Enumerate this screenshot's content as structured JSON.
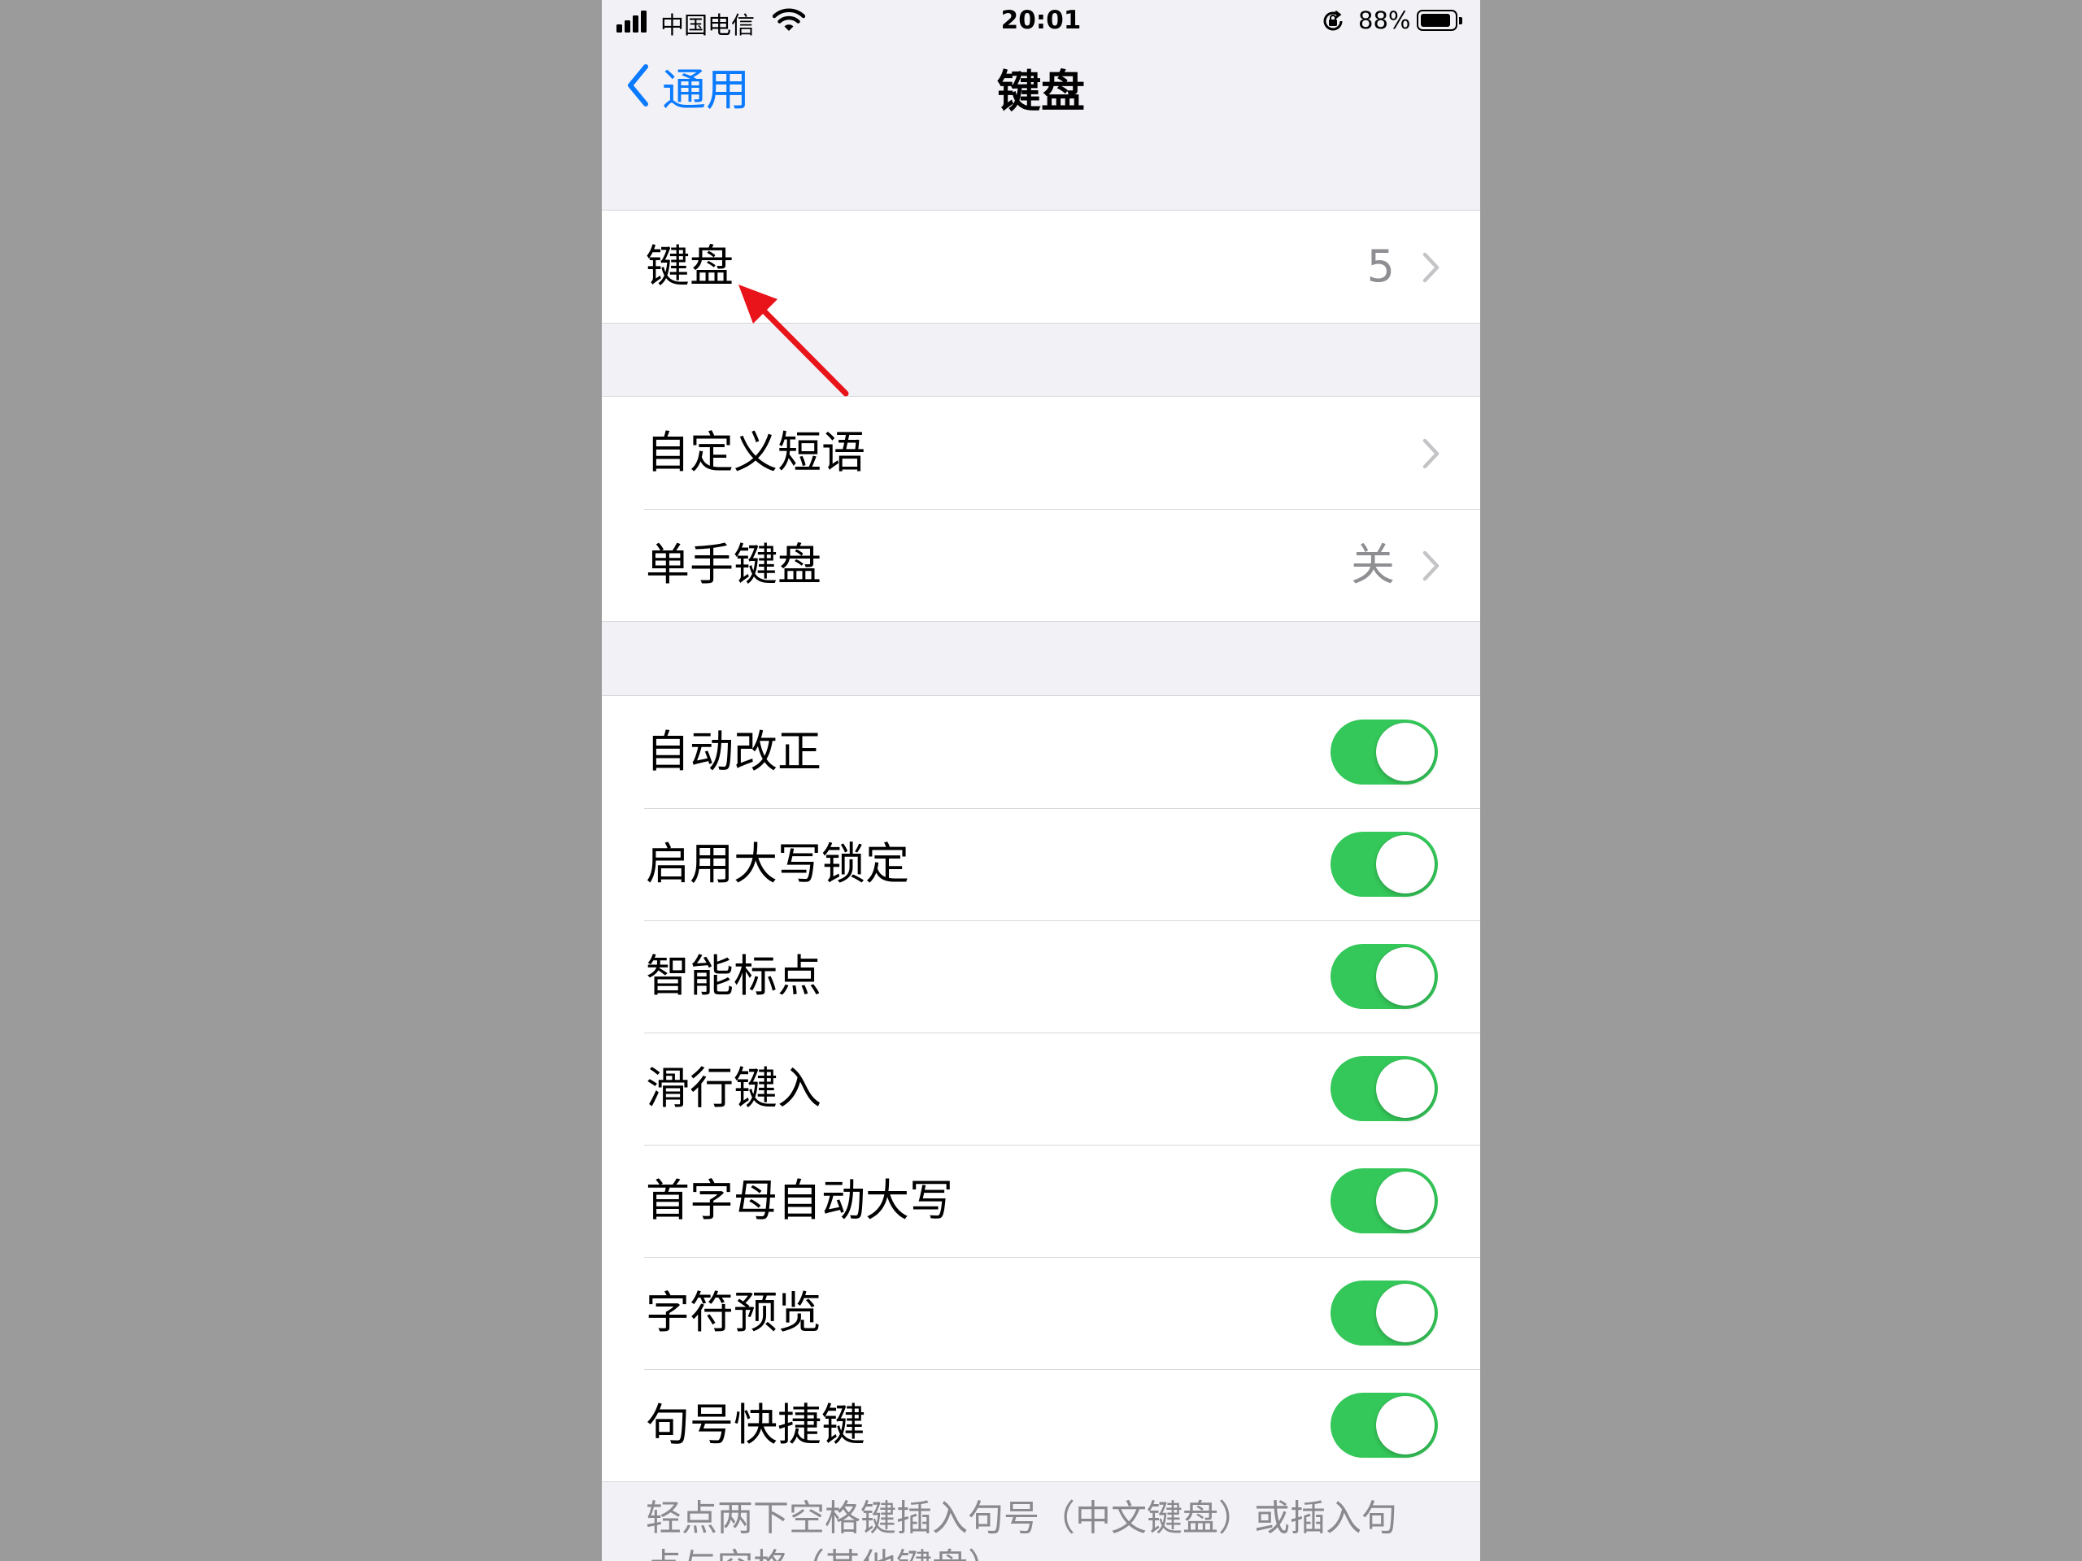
{
  "status_bar": {
    "carrier": "中国电信",
    "time": "20:01",
    "battery": "88%",
    "battery_level": 0.88,
    "icons": [
      "signal-icon",
      "wifi-icon",
      "rotation-lock-icon",
      "battery-icon"
    ]
  },
  "nav": {
    "back_label": "通用",
    "title": "键盘"
  },
  "groups": [
    {
      "rows": [
        {
          "label": "键盘",
          "value": "5",
          "type": "disclosure"
        }
      ]
    },
    {
      "rows": [
        {
          "label": "自定义短语",
          "value": "",
          "type": "disclosure"
        },
        {
          "label": "单手键盘",
          "value": "关",
          "type": "disclosure"
        }
      ]
    },
    {
      "rows": [
        {
          "label": "自动改正",
          "type": "toggle",
          "on": true
        },
        {
          "label": "启用大写锁定",
          "type": "toggle",
          "on": true
        },
        {
          "label": "智能标点",
          "type": "toggle",
          "on": true
        },
        {
          "label": "滑行键入",
          "type": "toggle",
          "on": true
        },
        {
          "label": "首字母自动大写",
          "type": "toggle",
          "on": true
        },
        {
          "label": "字符预览",
          "type": "toggle",
          "on": true
        },
        {
          "label": "句号快捷键",
          "type": "toggle",
          "on": true
        }
      ]
    }
  ],
  "footnote": "轻点两下空格键插入句号（中文键盘）或插入句点与空格（其他键盘）。",
  "colors": {
    "accent": "#0a7aff",
    "toggle_on": "#34c759",
    "annotation_arrow": "#e8141a"
  }
}
